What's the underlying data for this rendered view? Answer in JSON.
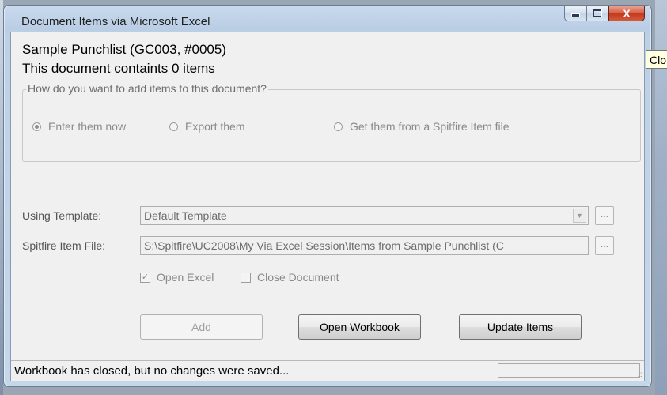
{
  "window": {
    "title": "Document Items via Microsoft Excel",
    "minimize_icon": "minimize-icon",
    "maximize_icon": "maximize-icon",
    "close_glyph": "X"
  },
  "tooltip": {
    "text": "Clo"
  },
  "header": {
    "document_name": "Sample Punchlist (GC003, #0005)",
    "item_count_text": "This document containts 0 items"
  },
  "add_group": {
    "legend": "How do you want to add items to this document?",
    "options": [
      {
        "label": "Enter them now",
        "checked": true
      },
      {
        "label": "Export them",
        "checked": false
      },
      {
        "label": "Get them from a Spitfire Item file",
        "checked": false
      }
    ]
  },
  "template": {
    "label": "Using Template:",
    "value": "Default Template",
    "browse_label": "..."
  },
  "item_file": {
    "label": "Spitfire Item File:",
    "value": "S:\\Spitfire\\UC2008\\My Via Excel Session\\Items from Sample Punchlist (C",
    "browse_label": "..."
  },
  "options": {
    "open_excel": {
      "label": "Open Excel",
      "checked": true
    },
    "close_document": {
      "label": "Close Document",
      "checked": false
    }
  },
  "buttons": {
    "add": "Add",
    "open_workbook": "Open Workbook",
    "update_items": "Update Items"
  },
  "status": {
    "message": "Workbook has closed, but no changes were saved...",
    "grip": ".::"
  },
  "colors": {
    "frame": "#b9cde4",
    "client": "#f0f0f0",
    "close_button": "#c23a1f",
    "tooltip_bg": "#ffffe1"
  }
}
